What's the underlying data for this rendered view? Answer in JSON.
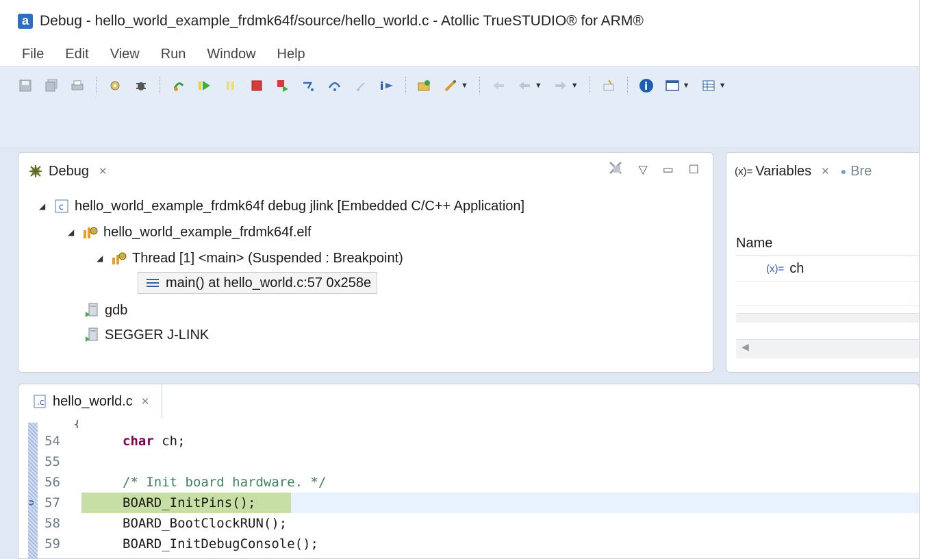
{
  "window": {
    "app_icon_letter": "a",
    "title": "Debug - hello_world_example_frdmk64f/source/hello_world.c - Atollic TrueSTUDIO® for ARM®"
  },
  "menu": [
    "File",
    "Edit",
    "View",
    "Run",
    "Window",
    "Help"
  ],
  "toolbar": {
    "icons": [
      "save-icon",
      "save-all-icon",
      "print-icon",
      "debug-config-icon",
      "bug-icon",
      "skip-breakpoints-icon",
      "resume-icon",
      "suspend-icon",
      "terminate-icon",
      "disconnect-icon",
      "step-into-icon",
      "step-over-icon",
      "step-return-icon",
      "instruction-step-icon",
      "open-project-icon",
      "build-icon",
      "back-icon",
      "back-arrow-icon",
      "forward-icon",
      "pin-icon",
      "info-icon",
      "window-icon",
      "grid-icon"
    ]
  },
  "debug_view": {
    "tab_label": "Debug",
    "tree": {
      "launch": "hello_world_example_frdmk64f debug jlink [Embedded C/C++ Application]",
      "elf": "hello_world_example_frdmk64f.elf",
      "thread": "Thread [1] <main> (Suspended : Breakpoint)",
      "frame": "main() at hello_world.c:57 0x258e",
      "gdb": "gdb",
      "jlink": "SEGGER J-LINK"
    }
  },
  "variables_view": {
    "tab_label": "Variables",
    "second_tab_label": "Bre",
    "column_name": "Name",
    "rows": [
      {
        "icon_label": "(x)=",
        "name": "ch"
      }
    ]
  },
  "editor": {
    "tab_label": "hello_world.c",
    "lines": [
      {
        "num": "54",
        "keyword": "char",
        "text": " ch;"
      },
      {
        "num": "55",
        "text": ""
      },
      {
        "num": "56",
        "comment": "/* Init board hardware. */"
      },
      {
        "num": "57",
        "text": "BOARD_InitPins();",
        "current": true
      },
      {
        "num": "58",
        "text": "BOARD_BootClockRUN();"
      },
      {
        "num": "59",
        "text": "BOARD_InitDebugConsole();"
      }
    ],
    "partial_top_line": "{"
  },
  "colors": {
    "window_bg": "#dfe8f3",
    "current_line": "#c7dfa5",
    "keyword": "#7f0055",
    "comment": "#3f7f5f",
    "accent": "#2c6fc2"
  }
}
